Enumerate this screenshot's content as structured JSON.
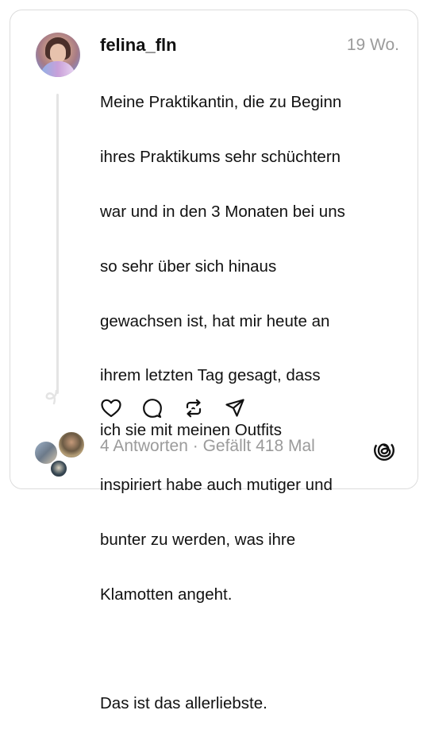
{
  "post": {
    "username": "felina_fln",
    "timestamp": "19 Wo.",
    "paragraphs": [
      "Meine Praktikantin, die zu Beginn ihres Praktikums sehr schüchtern war und in den 3 Monaten bei uns so sehr über sich hinaus gewachsen ist, hat mir heute an ihrem letzten Tag gesagt, dass ich sie mit meinen Outfits inspiriert habe auch mutiger und bunter zu werden, was ihre Klamotten angeht.",
      "Das ist das allerliebste."
    ],
    "lines_p1": [
      "Meine Praktikantin, die zu Beginn",
      "ihres Praktikums sehr schüchtern",
      "war und in den 3 Monaten bei uns",
      "so sehr über sich hinaus",
      "gewachsen ist, hat mir heute an",
      "ihrem letzten Tag gesagt, dass",
      "ich sie mit meinen Outfits",
      "inspiriert habe auch mutiger und",
      "bunter zu werden, was ihre",
      "Klamotten angeht."
    ],
    "stats": "4 Antworten · Gefällt 418 Mal"
  },
  "actions": {
    "like_icon": "heart-icon",
    "reply_icon": "comment-icon",
    "repost_icon": "repost-icon",
    "share_icon": "send-icon"
  },
  "colors": {
    "text": "#111111",
    "muted": "#9b9b9b",
    "border": "#dcdcdc",
    "thread_line": "#e4e4e4"
  }
}
